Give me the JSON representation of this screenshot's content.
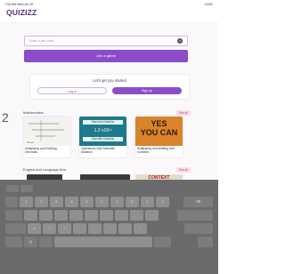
{
  "status_bar": {
    "time": "7:54 AM Wed Jul 20",
    "battery": "100%"
  },
  "app": {
    "logo": "QUIZIZZ"
  },
  "join": {
    "placeholder": "Enter a join code",
    "button_label": "Join a game"
  },
  "get_started": {
    "title": "Let's get you started",
    "login_label": "Log in",
    "signup_label": "Sign up"
  },
  "sections": [
    {
      "title": "Mathematics",
      "see_all": "See all",
      "tiles": [
        {
          "title": "Multiplying and Dividing Decimals",
          "tag": "29 Qs"
        },
        {
          "title": "Operations with Scientific Notation",
          "thumb_heading": "Standard Notation",
          "thumb_value": "1.2 x10¹¹",
          "thumb_sub": "Scientific Notation"
        },
        {
          "title": "Multiplying and dividing real numbers",
          "thumb_text": "YES\nYOU CAN"
        }
      ]
    },
    {
      "title": "English and Language Arts",
      "see_all": "See all",
      "tiles": [
        {
          "thumb_text": "CONTEXT"
        }
      ]
    }
  ],
  "edge_glyph": "2",
  "keyboard": {
    "row1": [
      "1",
      "2",
      "3",
      "4",
      "5",
      "6",
      "7",
      "8",
      "9",
      "0"
    ],
    "row3": [
      "#",
      "+",
      "=",
      "*",
      "!"
    ]
  },
  "colors": {
    "brand": "#8b4cc9",
    "logo": "#5b2f83"
  }
}
